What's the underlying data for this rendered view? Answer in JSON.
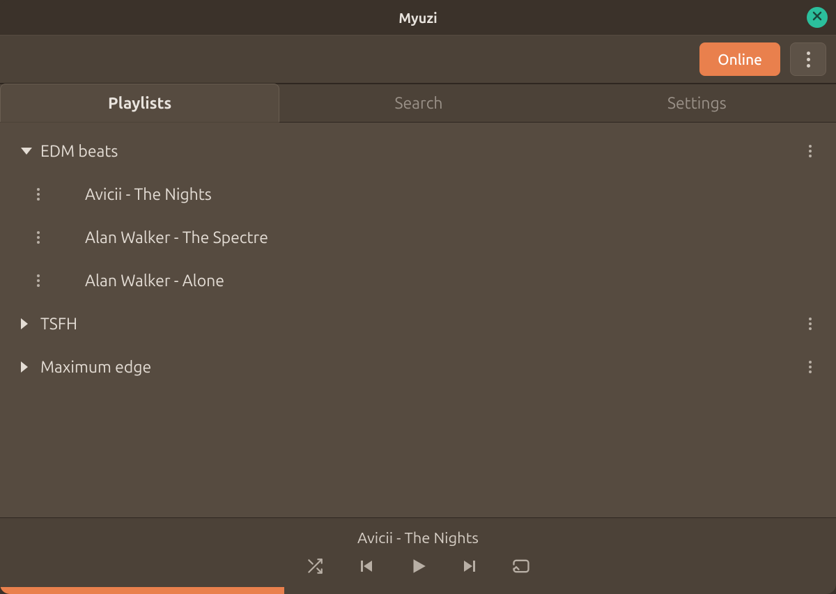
{
  "app_title": "Myuzi",
  "toolbar": {
    "online_label": "Online"
  },
  "tabs": [
    {
      "label": "Playlists",
      "active": true
    },
    {
      "label": "Search",
      "active": false
    },
    {
      "label": "Settings",
      "active": false
    }
  ],
  "playlists": [
    {
      "name": "EDM beats",
      "expanded": true,
      "tracks": [
        "Avicii - The Nights",
        "Alan Walker - The Spectre",
        "Alan Walker - Alone"
      ]
    },
    {
      "name": "TSFH",
      "expanded": false,
      "tracks": []
    },
    {
      "name": "Maximum edge",
      "expanded": false,
      "tracks": []
    }
  ],
  "player": {
    "now_playing": "Avicii - The Nights",
    "progress_percent": 34
  },
  "colors": {
    "accent": "#e9804d",
    "close_button": "#2bbf9c"
  }
}
